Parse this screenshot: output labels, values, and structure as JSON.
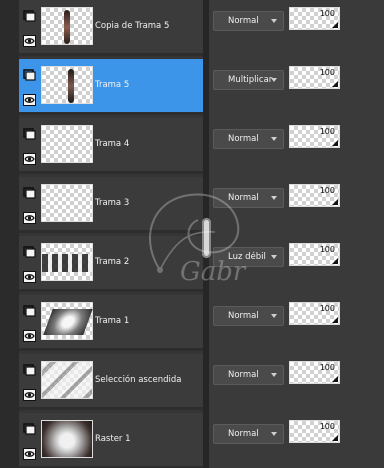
{
  "layers": [
    {
      "name": "Copia de Trama 5",
      "blend_mode": "Normal",
      "opacity": "100",
      "selected": false,
      "thumbnail": "figure"
    },
    {
      "name": "Trama 5",
      "blend_mode": "Multiplicar",
      "opacity": "100",
      "selected": true,
      "thumbnail": "figure"
    },
    {
      "name": "Trama 4",
      "blend_mode": "Normal",
      "opacity": "100",
      "selected": false,
      "thumbnail": "transparent"
    },
    {
      "name": "Trama 3",
      "blend_mode": "Normal",
      "opacity": "100",
      "selected": false,
      "thumbnail": "transparent"
    },
    {
      "name": "Trama 2",
      "blend_mode": "Luz débil",
      "opacity": "100",
      "selected": false,
      "thumbnail": "bands"
    },
    {
      "name": "Trama 1",
      "blend_mode": "Normal",
      "opacity": "100",
      "selected": false,
      "thumbnail": "diamond"
    },
    {
      "name": "Selección ascendida",
      "blend_mode": "Normal",
      "opacity": "100",
      "selected": false,
      "thumbnail": "waves"
    },
    {
      "name": "Raster 1",
      "blend_mode": "Normal",
      "opacity": "100",
      "selected": false,
      "thumbnail": "raster"
    }
  ],
  "icons": {
    "layer_visibility_top": "layer-icon",
    "layer_visibility_bottom": "eye-icon",
    "blend_dropdown": "chevron-down-icon",
    "opacity_adjust": "resize-icon",
    "divider_handle": "grip-icon"
  },
  "colors": {
    "panel_bg": "#353535",
    "row_bg": "#3b3b3b",
    "selected_bg": "#3d95ea",
    "control_bg": "#4a4a4a",
    "text": "#f2f2f2"
  }
}
